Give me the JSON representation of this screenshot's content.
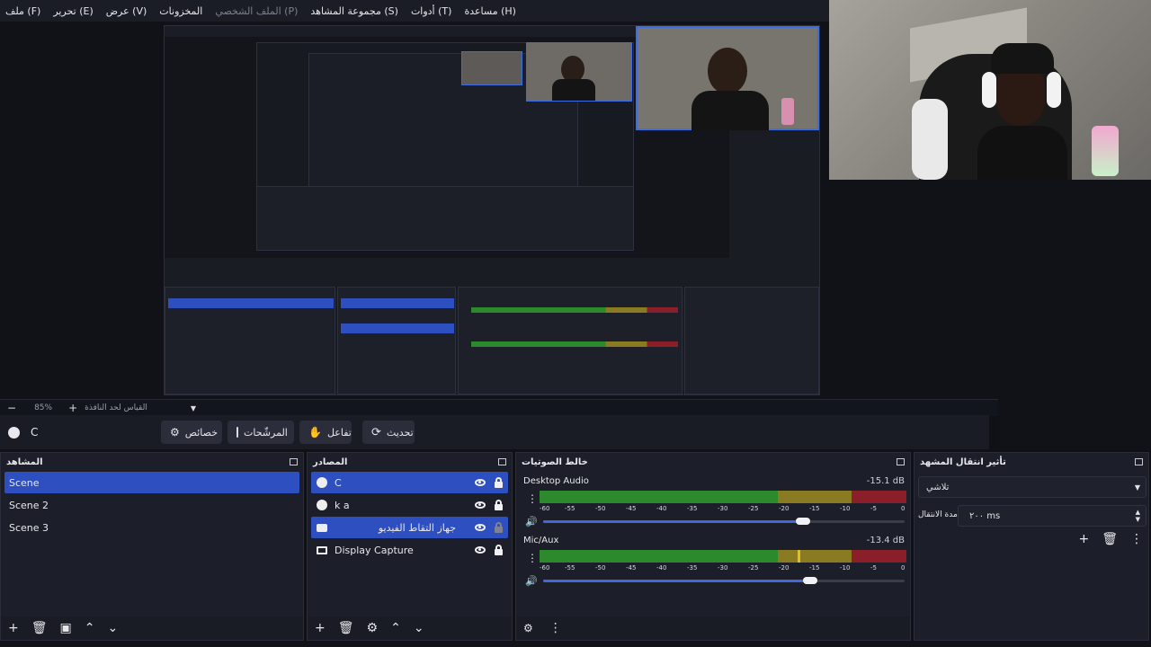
{
  "menubar": {
    "items": [
      {
        "label": "ملف (F)"
      },
      {
        "label": "تحرير (E)"
      },
      {
        "label": "عرض (V)"
      },
      {
        "label": "المخزونات"
      },
      {
        "label": "الملف الشخصي (P)"
      },
      {
        "label": "مجموعة المشاهد (S)"
      },
      {
        "label": "أدوات (T)"
      },
      {
        "label": "مساعدة (H)"
      }
    ]
  },
  "zoom": {
    "value": "85%",
    "fit_label": "القياس لحد النافذة"
  },
  "scene_bar": {
    "current_source": "C"
  },
  "controls": {
    "properties": "خصائص",
    "filters": "المرشّحات",
    "interact": "تفاعل",
    "refresh": "تحديث"
  },
  "scenes_dock": {
    "title": "المشاهد",
    "items": [
      {
        "label": "Scene",
        "selected": true
      },
      {
        "label": "Scene 2",
        "selected": false
      },
      {
        "label": "Scene 3",
        "selected": false
      }
    ]
  },
  "sources_dock": {
    "title": "المصادر",
    "items": [
      {
        "label": "C",
        "icon": "browser-icon",
        "selected": true
      },
      {
        "label": "k a",
        "icon": "browser-icon",
        "selected": false
      },
      {
        "label": "جهاز التقاط الفيديو",
        "icon": "camera-icon",
        "selected": true
      },
      {
        "label": "Display Capture",
        "icon": "monitor-icon",
        "selected": false
      }
    ]
  },
  "mixer_dock": {
    "title": "خالط الصوتيات",
    "tracks": [
      {
        "name": "Desktop Audio",
        "db": "-15.1 dB",
        "volume": 0.72
      },
      {
        "name": "Mic/Aux",
        "db": "-13.4 dB",
        "volume": 0.74
      }
    ],
    "ticks": [
      "-60",
      "-55",
      "-50",
      "-45",
      "-40",
      "-35",
      "-30",
      "-25",
      "-20",
      "-15",
      "-10",
      "-5",
      "0"
    ]
  },
  "transition_dock": {
    "title": "تأثير انتقال المشهد",
    "transition": "تلاشي",
    "duration_label": "مدة الانتقال",
    "duration_value": "٢٠٠ ms"
  },
  "colors": {
    "accent": "#2e4fc0",
    "panel": "#1c1f29",
    "meter_green": "#2c8a2c",
    "meter_yellow": "#8a7a22",
    "meter_red": "#8a1f2a"
  }
}
